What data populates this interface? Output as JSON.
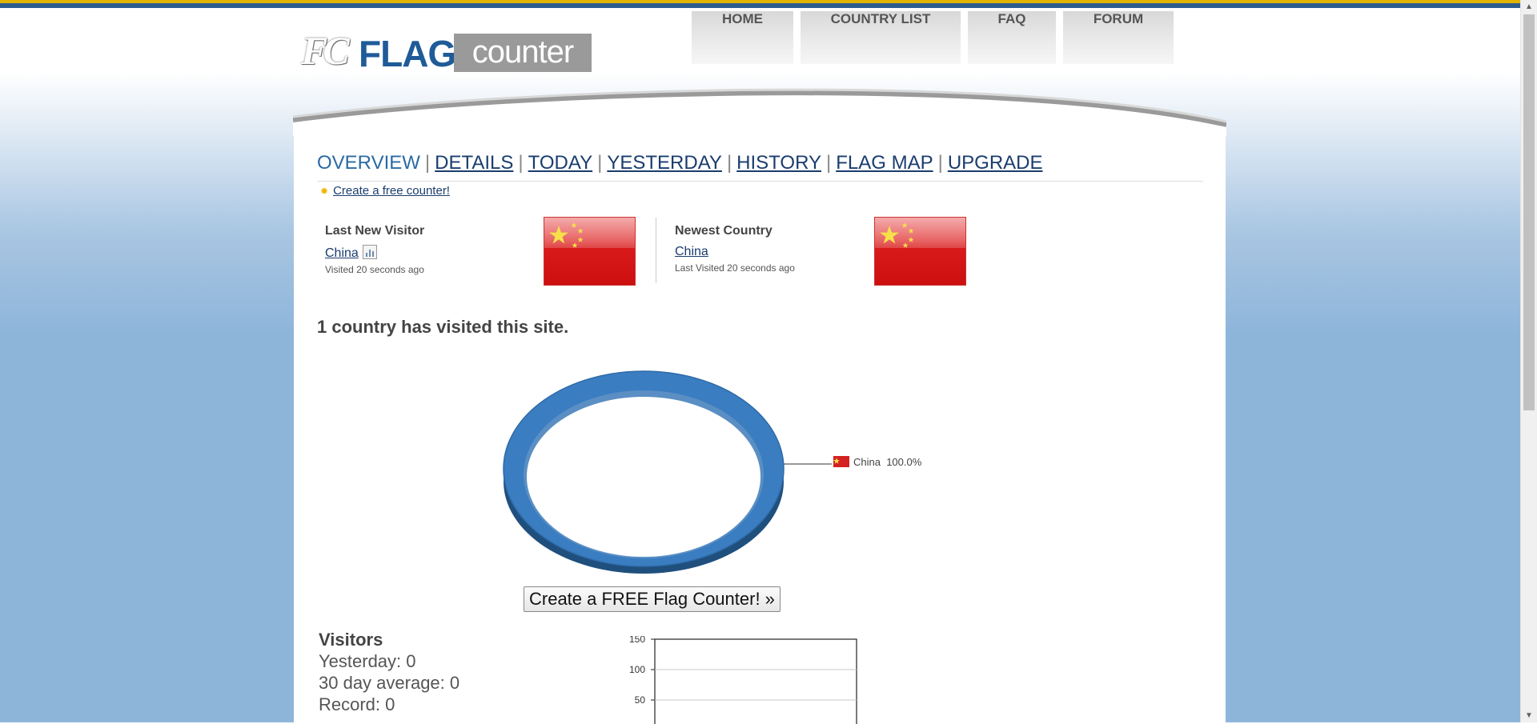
{
  "logo": {
    "fc": "FC",
    "flag": "FLAG",
    "counter": "counter"
  },
  "nav": {
    "home": "HOME",
    "country_list": "COUNTRY LIST",
    "faq": "FAQ",
    "forum": "FORUM"
  },
  "tabs": {
    "overview": "OVERVIEW",
    "details": "DETAILS",
    "today": "TODAY",
    "yesterday": "YESTERDAY",
    "history": "HISTORY",
    "flag_map": "FLAG MAP",
    "upgrade": "UPGRADE",
    "separator": "|"
  },
  "create_link": "Create a free counter!",
  "last_new_visitor": {
    "title": "Last New Visitor",
    "country": "China",
    "visited": "Visited 20 seconds ago"
  },
  "newest_country": {
    "title": "Newest Country",
    "country": "China",
    "visited": "Last Visited 20 seconds ago"
  },
  "country_count": "1 country has visited this site.",
  "pie": {
    "legend_country": "China",
    "legend_percent": "100.0%"
  },
  "create_button": "Create a FREE Flag Counter! »",
  "visitors": {
    "title": "Visitors",
    "yesterday": "Yesterday: 0",
    "average": "30 day average: 0",
    "record": "Record: 0"
  },
  "chart_data": {
    "type": "line",
    "title": "",
    "xlabel": "",
    "ylabel": "",
    "y_ticks": [
      "150",
      "100",
      "50"
    ],
    "ylim": [
      0,
      150
    ],
    "series": [],
    "grid": true
  },
  "colors": {
    "accent": "#2a6aa5",
    "link": "#1a3d6e",
    "pie": "#3a7dc1",
    "china_red": "#d81a1a"
  }
}
